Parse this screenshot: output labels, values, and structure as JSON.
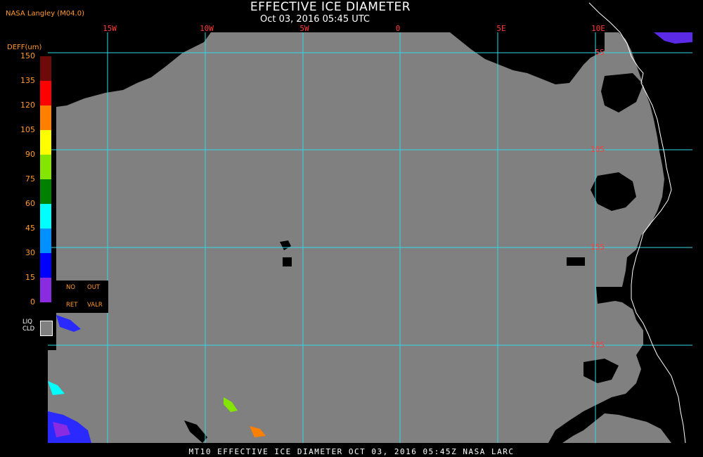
{
  "header": {
    "title": "EFFECTIVE ICE DIAMETER",
    "subtitle": "Oct 03, 2016 05:45 UTC",
    "credit": "NASA Langley (M04.0)"
  },
  "footer": {
    "text": "MT10  EFFECTIVE ICE DIAMETER  OCT 03, 2016 05:45Z  NASA LARC"
  },
  "legend": {
    "unit_label": "DEFF(um)",
    "ticks": [
      "150",
      "135",
      "120",
      "105",
      "90",
      "75",
      "60",
      "45",
      "30",
      "15",
      "0"
    ],
    "colors": [
      "#6e0a0a",
      "#ff0000",
      "#ff7f00",
      "#ffff00",
      "#84e600",
      "#008000",
      "#00ffff",
      "#0090ff",
      "#0000ff",
      "#8a2be2"
    ],
    "key": {
      "no": "NO",
      "out": "OUT",
      "ret": "RET",
      "valr": "VALR"
    },
    "liq_line1": "LIQ",
    "liq_line2": "CLD",
    "liq_color": "#808080"
  },
  "map": {
    "lon_labels": [
      "15W",
      "10W",
      "5W",
      "0",
      "5E",
      "10E"
    ],
    "lat_labels": [
      "5S",
      "10S",
      "15S",
      "20S"
    ],
    "grid_color": "#2fd7e6",
    "label_color": "#ff3b3b",
    "cloud_color": "#808080",
    "coast_color": "#ffffff"
  }
}
